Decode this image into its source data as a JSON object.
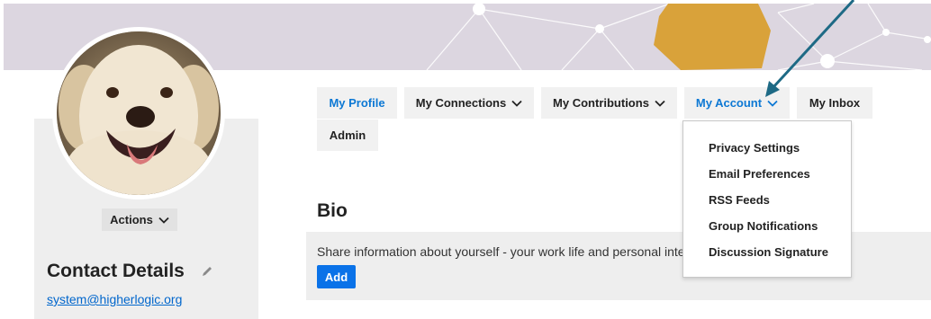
{
  "colors": {
    "accent": "#0c78d4",
    "button_primary": "#0a72e8",
    "banner_bg": "#dcd6e0",
    "banner_shape": "#d9a23a",
    "panel_bg": "#eeeeee",
    "tab_bg": "#f1f1f1",
    "arrow": "#1e6a85"
  },
  "profile": {
    "avatar_alt": "dog",
    "actions_label": "Actions",
    "contact_title": "Contact Details",
    "email": "system@higherlogic.org"
  },
  "nav": {
    "tabs": [
      {
        "label": "My Profile",
        "active": true,
        "dropdown": false
      },
      {
        "label": "My Connections",
        "active": false,
        "dropdown": true
      },
      {
        "label": "My Contributions",
        "active": false,
        "dropdown": true
      },
      {
        "label": "My Account",
        "active": true,
        "dropdown": true
      },
      {
        "label": "My Inbox",
        "active": false,
        "dropdown": false
      },
      {
        "label": "Admin",
        "active": false,
        "dropdown": false
      }
    ]
  },
  "account_menu": {
    "items": [
      "Privacy Settings",
      "Email Preferences",
      "RSS Feeds",
      "Group Notifications",
      "Discussion Signature"
    ]
  },
  "bio": {
    "title": "Bio",
    "text": "Share information about yourself - your work life and personal interests.",
    "add_label": "Add"
  }
}
